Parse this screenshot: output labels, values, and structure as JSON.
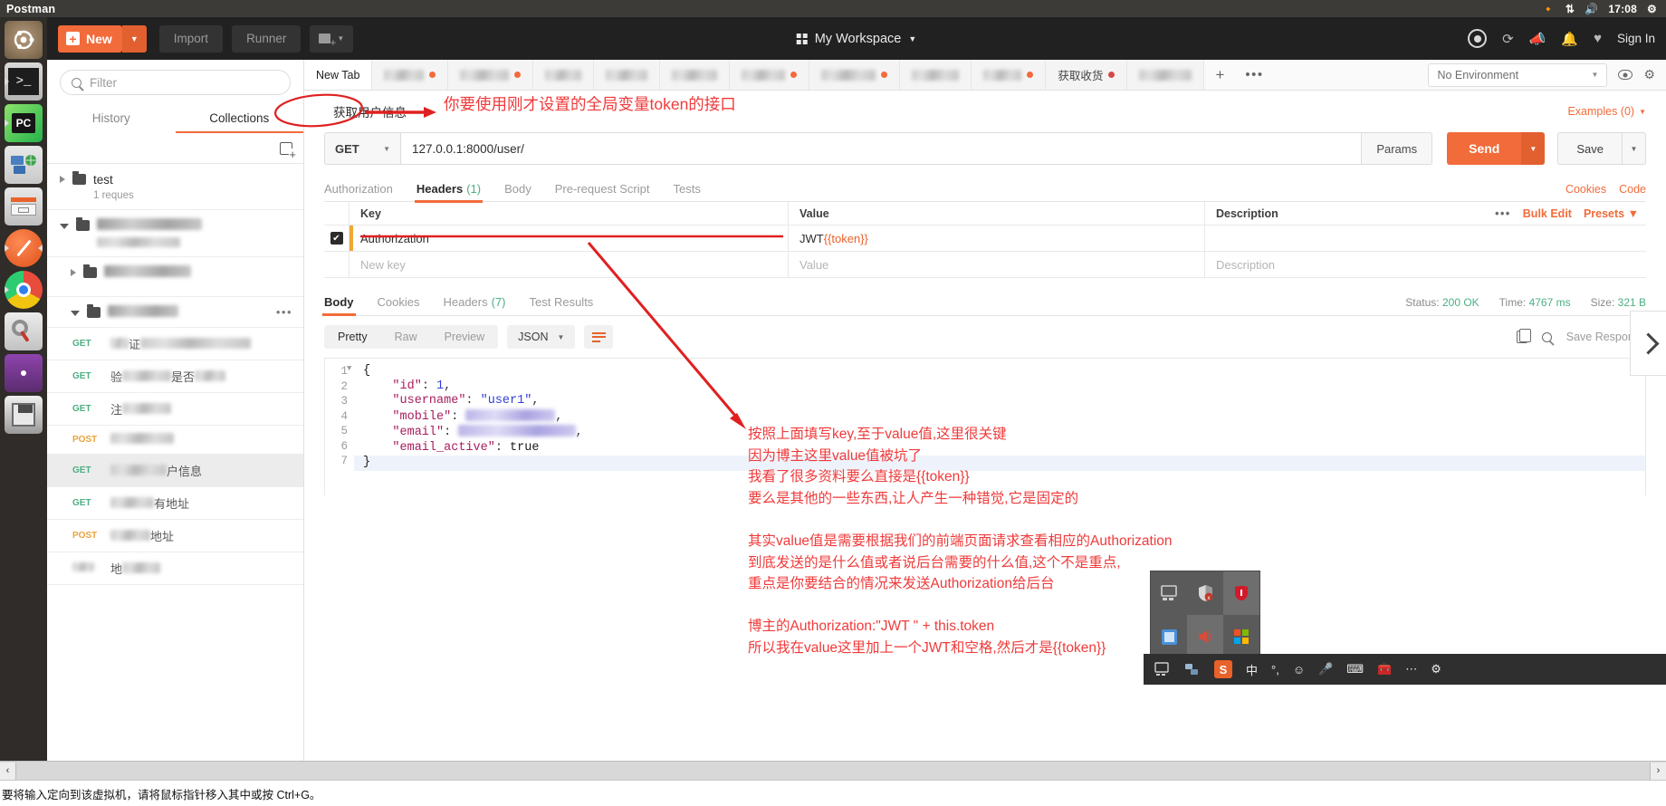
{
  "vm": {
    "title": "Postman",
    "bottom_hint": "要将输入定向到该虚拟机，请将鼠标指针移入其中或按 Ctrl+G。",
    "clock": "17:08"
  },
  "launcher": {
    "items": [
      {
        "name": "ubuntu-dash",
        "icon": "ubuntu-logo"
      },
      {
        "name": "terminal",
        "icon": "terminal-icon"
      },
      {
        "name": "pycharm",
        "icon": "pycharm-icon",
        "label": "PC"
      },
      {
        "name": "network",
        "icon": "network-icon"
      },
      {
        "name": "files",
        "icon": "file-manager-icon"
      },
      {
        "name": "postman",
        "icon": "postman-icon"
      },
      {
        "name": "chrome",
        "icon": "chrome-icon"
      },
      {
        "name": "settings",
        "icon": "settings-tools-icon"
      },
      {
        "name": "media",
        "icon": "media-icon"
      },
      {
        "name": "save",
        "icon": "save-icon"
      }
    ]
  },
  "toolbar": {
    "new_label": "New",
    "import_label": "Import",
    "runner_label": "Runner",
    "workspace_label": "My Workspace",
    "signin_label": "Sign In"
  },
  "sidebar": {
    "filter_placeholder": "Filter",
    "tabs": [
      {
        "label": "History",
        "active": false
      },
      {
        "label": "Collections",
        "active": true
      }
    ],
    "collections": [
      {
        "name": "test",
        "sub": "1 reques",
        "blurred": false,
        "open": false
      },
      {
        "name": "",
        "sub": "",
        "blurred": true,
        "open": true
      }
    ],
    "folders": [
      {
        "name": "",
        "blurred": true,
        "open": false,
        "indent": 1
      },
      {
        "name": "",
        "blurred": true,
        "open": true,
        "indent": 1
      }
    ],
    "requests": [
      {
        "method": "GET",
        "name_visible": "证",
        "blurred": true,
        "selected": false
      },
      {
        "method": "GET",
        "name_visible": "验    是否    证",
        "blurred": true,
        "selected": false
      },
      {
        "method": "GET",
        "name_visible": "注",
        "blurred": true,
        "selected": false
      },
      {
        "method": "POST",
        "name_visible": "",
        "blurred": true,
        "selected": false
      },
      {
        "method": "GET",
        "name_visible": "户信息",
        "blurred": true,
        "selected": true
      },
      {
        "method": "GET",
        "name_visible": "有地址",
        "blurred": true,
        "selected": false
      },
      {
        "method": "POST",
        "name_visible": "地址",
        "blurred": true,
        "selected": false
      },
      {
        "method": "",
        "name_visible": "地",
        "blurred": true,
        "selected": false
      }
    ]
  },
  "tabstrip": {
    "tabs": [
      {
        "label": "New Tab",
        "active": true,
        "dot": ""
      },
      {
        "label": "",
        "blurred": true,
        "dot": "orange"
      },
      {
        "label": "货举标件",
        "blurred": true,
        "dot": "orange"
      },
      {
        "label": "",
        "blurred": true,
        "dot": ""
      },
      {
        "label": "",
        "blurred": true,
        "dot": ""
      },
      {
        "label": "",
        "blurred": true,
        "dot": ""
      },
      {
        "label": "货装标件",
        "blurred": true,
        "dot": "orange"
      },
      {
        "label": "",
        "blurred": true,
        "dot": ""
      },
      {
        "label": "",
        "blurred": true,
        "dot": ""
      },
      {
        "label": "",
        "blurred": true,
        "dot": ""
      },
      {
        "label": "获取收货",
        "blurred": false,
        "dot": "red"
      },
      {
        "label": "",
        "blurred": true,
        "dot": ""
      }
    ],
    "add_label": "+",
    "more_label": "•••",
    "environment": "No Environment"
  },
  "request": {
    "name": "获取用户信息",
    "examples_label": "Examples (0)",
    "method": "GET",
    "url": "127.0.0.1:8000/user/",
    "params_label": "Params",
    "send_label": "Send",
    "save_label": "Save",
    "tabs": [
      {
        "label": "Authorization",
        "active": false,
        "count": ""
      },
      {
        "label": "Headers",
        "active": true,
        "count": "(1)"
      },
      {
        "label": "Body",
        "active": false,
        "count": ""
      },
      {
        "label": "Pre-request Script",
        "active": false,
        "count": ""
      },
      {
        "label": "Tests",
        "active": false,
        "count": ""
      }
    ],
    "tabs_right": [
      {
        "label": "Cookies"
      },
      {
        "label": "Code"
      }
    ]
  },
  "headers_table": {
    "columns": [
      "Key",
      "Value",
      "Description"
    ],
    "bulk_edit_label": "Bulk Edit",
    "presets_label": "Presets",
    "more_label": "•••",
    "rows": [
      {
        "checked": true,
        "key": "Authorization",
        "value_prefix": "JWT ",
        "value_var": "{{token}}",
        "description": ""
      }
    ],
    "placeholder_row": {
      "key": "New key",
      "value": "Value",
      "description": "Description"
    }
  },
  "response": {
    "tabs": [
      {
        "label": "Body",
        "active": true,
        "count": ""
      },
      {
        "label": "Cookies",
        "active": false,
        "count": ""
      },
      {
        "label": "Headers",
        "active": false,
        "count": "(7)"
      },
      {
        "label": "Test Results",
        "active": false,
        "count": ""
      }
    ],
    "status_label": "Status:",
    "status_value": "200 OK",
    "time_label": "Time:",
    "time_value": "4767 ms",
    "size_label": "Size:",
    "size_value": "321 B",
    "view_modes": [
      {
        "label": "Pretty",
        "active": true
      },
      {
        "label": "Raw",
        "active": false
      },
      {
        "label": "Preview",
        "active": false
      }
    ],
    "format": "JSON",
    "save_response_label": "Save Response",
    "body_lines": [
      {
        "num": "1",
        "fold": true,
        "tokens": [
          {
            "t": "{",
            "c": "b"
          }
        ]
      },
      {
        "num": "2",
        "fold": false,
        "tokens": [
          {
            "t": "    ",
            "c": "p"
          },
          {
            "t": "\"id\"",
            "c": "k"
          },
          {
            "t": ": ",
            "c": "p"
          },
          {
            "t": "1",
            "c": "n"
          },
          {
            "t": ",",
            "c": "p"
          }
        ]
      },
      {
        "num": "3",
        "fold": false,
        "tokens": [
          {
            "t": "    ",
            "c": "p"
          },
          {
            "t": "\"username\"",
            "c": "k"
          },
          {
            "t": ": ",
            "c": "p"
          },
          {
            "t": "\"user1\"",
            "c": "s"
          },
          {
            "t": ",",
            "c": "p"
          }
        ]
      },
      {
        "num": "4",
        "fold": false,
        "tokens": [
          {
            "t": "    ",
            "c": "p"
          },
          {
            "t": "\"mobile\"",
            "c": "k"
          },
          {
            "t": ": ",
            "c": "p"
          },
          {
            "t": "\"___________\"",
            "c": "blur"
          },
          {
            "t": ",",
            "c": "p"
          }
        ]
      },
      {
        "num": "5",
        "fold": false,
        "tokens": [
          {
            "t": "    ",
            "c": "p"
          },
          {
            "t": "\"email\"",
            "c": "k"
          },
          {
            "t": ": ",
            "c": "p"
          },
          {
            "t": "\"_______________\"",
            "c": "blur"
          },
          {
            "t": ",",
            "c": "p"
          }
        ]
      },
      {
        "num": "6",
        "fold": false,
        "tokens": [
          {
            "t": "    ",
            "c": "p"
          },
          {
            "t": "\"email_active\"",
            "c": "k"
          },
          {
            "t": ": ",
            "c": "p"
          },
          {
            "t": "true",
            "c": "b"
          }
        ]
      },
      {
        "num": "7",
        "fold": false,
        "highlight": true,
        "tokens": [
          {
            "t": "}",
            "c": "b"
          }
        ]
      }
    ]
  },
  "annotations": {
    "top_text": "你要使用刚才设置的全局变量token的接口",
    "block_lines": [
      "按照上面填写key,至于value值,这里很关键",
      "因为博主这里value值被坑了",
      "我看了很多资料要么直接是{{token}}",
      "要么是其他的一些东西,让人产生一种错觉,它是固定的",
      "",
      "其实value值是需要根据我们的前端页面请求查看相应的Authorization",
      "到底发送的是什么值或者说后台需要的什么值,这个不是重点,",
      "重点是你要结合的情况来发送Authorization给后台",
      "",
      "博主的Authorization:\"JWT \" + this.token",
      "所以我在value这里加上一个JWT和空格,然后才是{{token}}"
    ]
  },
  "colors": {
    "accent": "#f26b3a",
    "annotation_red": "#f03a3a",
    "status_green": "#4caf82",
    "toolbar_dark": "#212121"
  }
}
